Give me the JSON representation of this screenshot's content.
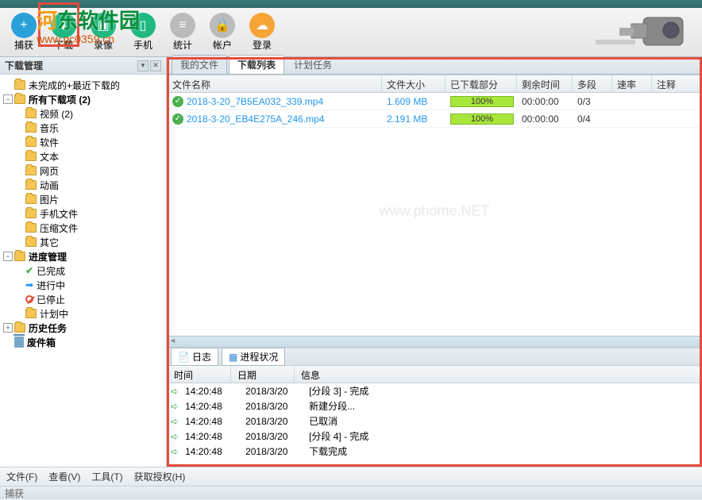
{
  "watermark": {
    "brand_prefix": "河",
    "brand_suffix": "东软件园",
    "url": "www.pc0359.cn"
  },
  "toolbar": {
    "add": "捕获",
    "download": "下载",
    "record": "录像",
    "phone": "手机",
    "stats": "统计",
    "account": "帐户",
    "login": "登录"
  },
  "sidebar": {
    "title": "下载管理",
    "items": {
      "incomplete": "未完成的+最近下载的",
      "all_downloads": "所有下载项 (2)",
      "video": "视频 (2)",
      "music": "音乐",
      "software": "软件",
      "text": "文本",
      "webpage": "网页",
      "animation": "动画",
      "image": "图片",
      "phone_files": "手机文件",
      "compressed": "压缩文件",
      "other": "其它",
      "progress": "进度管理",
      "done": "已完成",
      "running": "进行中",
      "stopped": "已停止",
      "scheduled": "计划中",
      "history": "历史任务",
      "trash": "废件箱"
    }
  },
  "tabs": {
    "my_files": "我的文件",
    "download_list": "下载列表",
    "scheduled": "计划任务"
  },
  "columns": {
    "name": "文件名称",
    "size": "文件大小",
    "progress": "已下载部分",
    "remain": "剩余时间",
    "seg": "多段",
    "rate": "速率",
    "note": "注释"
  },
  "rows": [
    {
      "name": "2018-3-20_7B5EA032_339.mp4",
      "size": "1.609 MB",
      "progress": "100%",
      "time": "00:00:00",
      "seg": "0/3"
    },
    {
      "name": "2018-3-20_EB4E275A_246.mp4",
      "size": "2.191 MB",
      "progress": "100%",
      "time": "00:00:00",
      "seg": "0/4"
    }
  ],
  "log": {
    "tabs": {
      "log": "日志",
      "process": "进程状况"
    },
    "columns": {
      "time": "时间",
      "date": "日期",
      "info": "信息"
    },
    "rows": [
      {
        "time": "14:20:48",
        "date": "2018/3/20",
        "info": "[分段 3] - 完成"
      },
      {
        "time": "14:20:48",
        "date": "2018/3/20",
        "info": "新建分段..."
      },
      {
        "time": "14:20:48",
        "date": "2018/3/20",
        "info": "已取消"
      },
      {
        "time": "14:20:48",
        "date": "2018/3/20",
        "info": "[分段 4] - 完成"
      },
      {
        "time": "14:20:48",
        "date": "2018/3/20",
        "info": "下载完成"
      }
    ]
  },
  "menu": {
    "file": "文件(F)",
    "view": "查看(V)",
    "tools": "工具(T)",
    "license": "获取授权(H)"
  },
  "status": "捕获"
}
